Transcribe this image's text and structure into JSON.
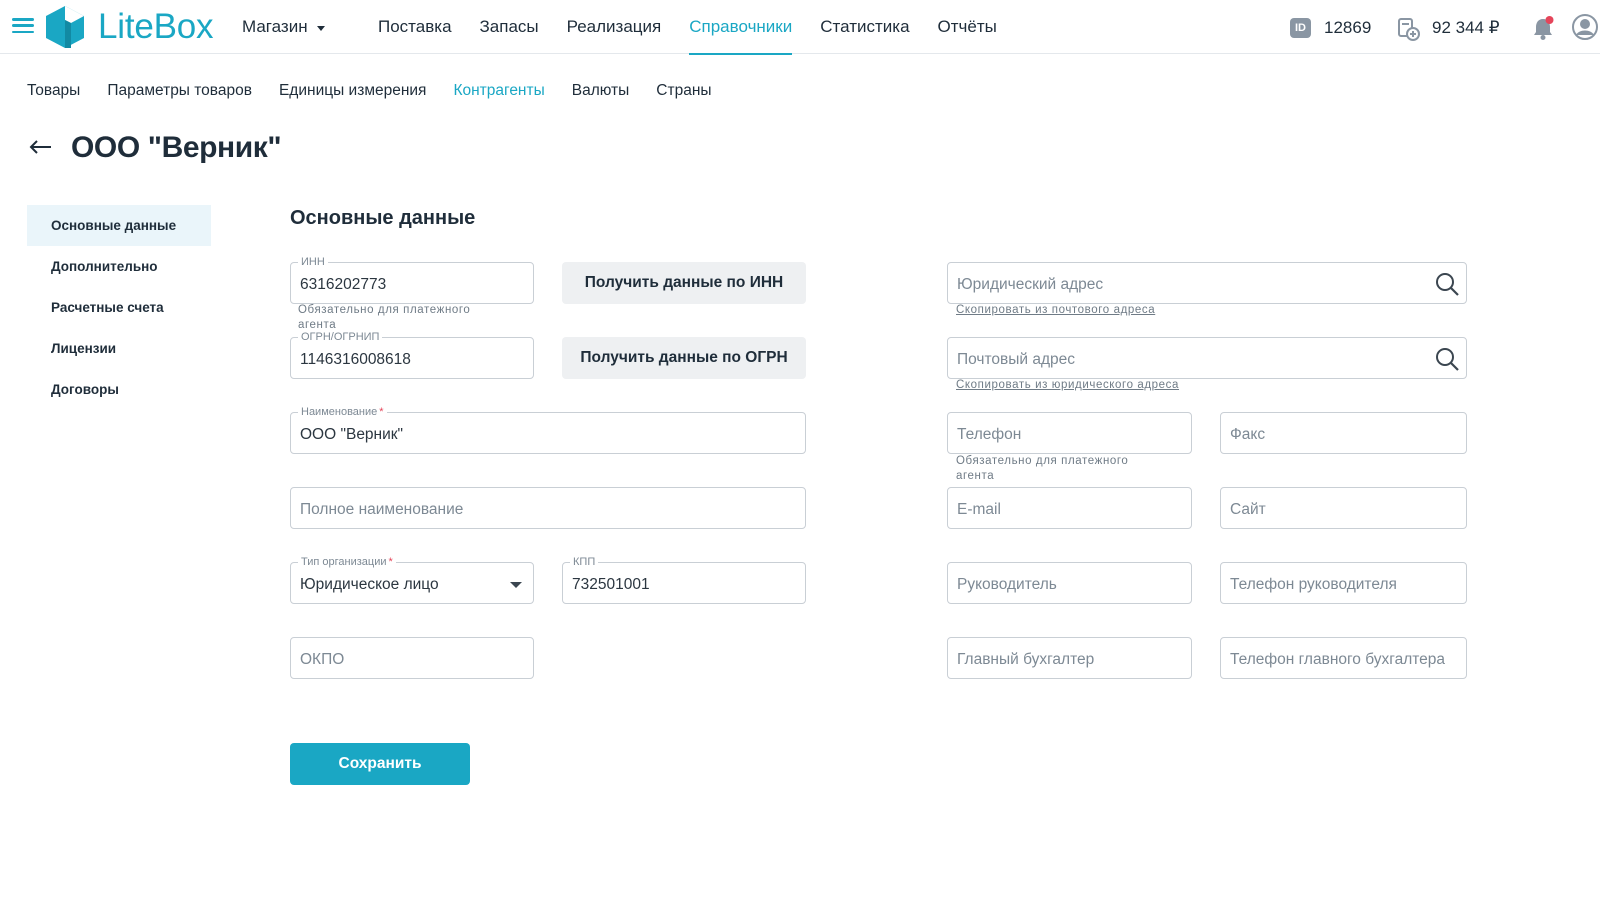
{
  "header": {
    "logo_text": "LiteBox",
    "store_selector": "Магазин",
    "nav": [
      {
        "label": "Поставка",
        "active": false
      },
      {
        "label": "Запасы",
        "active": false
      },
      {
        "label": "Реализация",
        "active": false
      },
      {
        "label": "Справочники",
        "active": true
      },
      {
        "label": "Статистика",
        "active": false
      },
      {
        "label": "Отчёты",
        "active": false
      }
    ],
    "id_badge": "ID",
    "account_id": "12869",
    "balance": "92 344 ₽",
    "accent_color": "#1aa7c4"
  },
  "subnav": [
    {
      "label": "Товары",
      "active": false
    },
    {
      "label": "Параметры товаров",
      "active": false
    },
    {
      "label": "Единицы измерения",
      "active": false
    },
    {
      "label": "Контрагенты",
      "active": true
    },
    {
      "label": "Валюты",
      "active": false
    },
    {
      "label": "Страны",
      "active": false
    }
  ],
  "page": {
    "title": "ООО \"Верник\""
  },
  "sidemenu": [
    {
      "label": "Основные данные",
      "active": true
    },
    {
      "label": "Дополнительно",
      "active": false
    },
    {
      "label": "Расчетные счета",
      "active": false
    },
    {
      "label": "Лицензии",
      "active": false
    },
    {
      "label": "Договоры",
      "active": false
    }
  ],
  "form": {
    "section_title": "Основные данные",
    "inn": {
      "label": "ИНН",
      "value": "6316202773",
      "hint": "Обязательно для платежного агента"
    },
    "ogrn": {
      "label": "ОГРН/ОГРНИП",
      "value": "1146316008618"
    },
    "get_by_inn_button": "Получить данные по ИНН",
    "get_by_ogrn_button": "Получить данные по ОГРН",
    "name": {
      "label": "Наименование",
      "required_mark": "*",
      "value": "ООО \"Верник\""
    },
    "full_name": {
      "placeholder": "Полное наименование"
    },
    "org_type": {
      "label": "Тип организации",
      "required_mark": "*",
      "value": "Юридическое лицо"
    },
    "kpp": {
      "label": "КПП",
      "value": "732501001"
    },
    "okpo": {
      "placeholder": "ОКПО"
    },
    "legal_address": {
      "placeholder": "Юридический адрес",
      "copy_link": "Скопировать из почтового адреса"
    },
    "postal_address": {
      "placeholder": "Почтовый адрес",
      "copy_link": "Скопировать из юридического адреса"
    },
    "phone": {
      "placeholder": "Телефон",
      "hint": "Обязательно для платежного агента"
    },
    "fax": {
      "placeholder": "Факс"
    },
    "email": {
      "placeholder": "E-mail"
    },
    "site": {
      "placeholder": "Сайт"
    },
    "director": {
      "placeholder": "Руководитель"
    },
    "director_phone": {
      "placeholder": "Телефон руководителя"
    },
    "accountant": {
      "placeholder": "Главный бухгалтер"
    },
    "accountant_phone": {
      "placeholder": "Телефон главного бухгалтера"
    },
    "save_button": "Сохранить"
  }
}
